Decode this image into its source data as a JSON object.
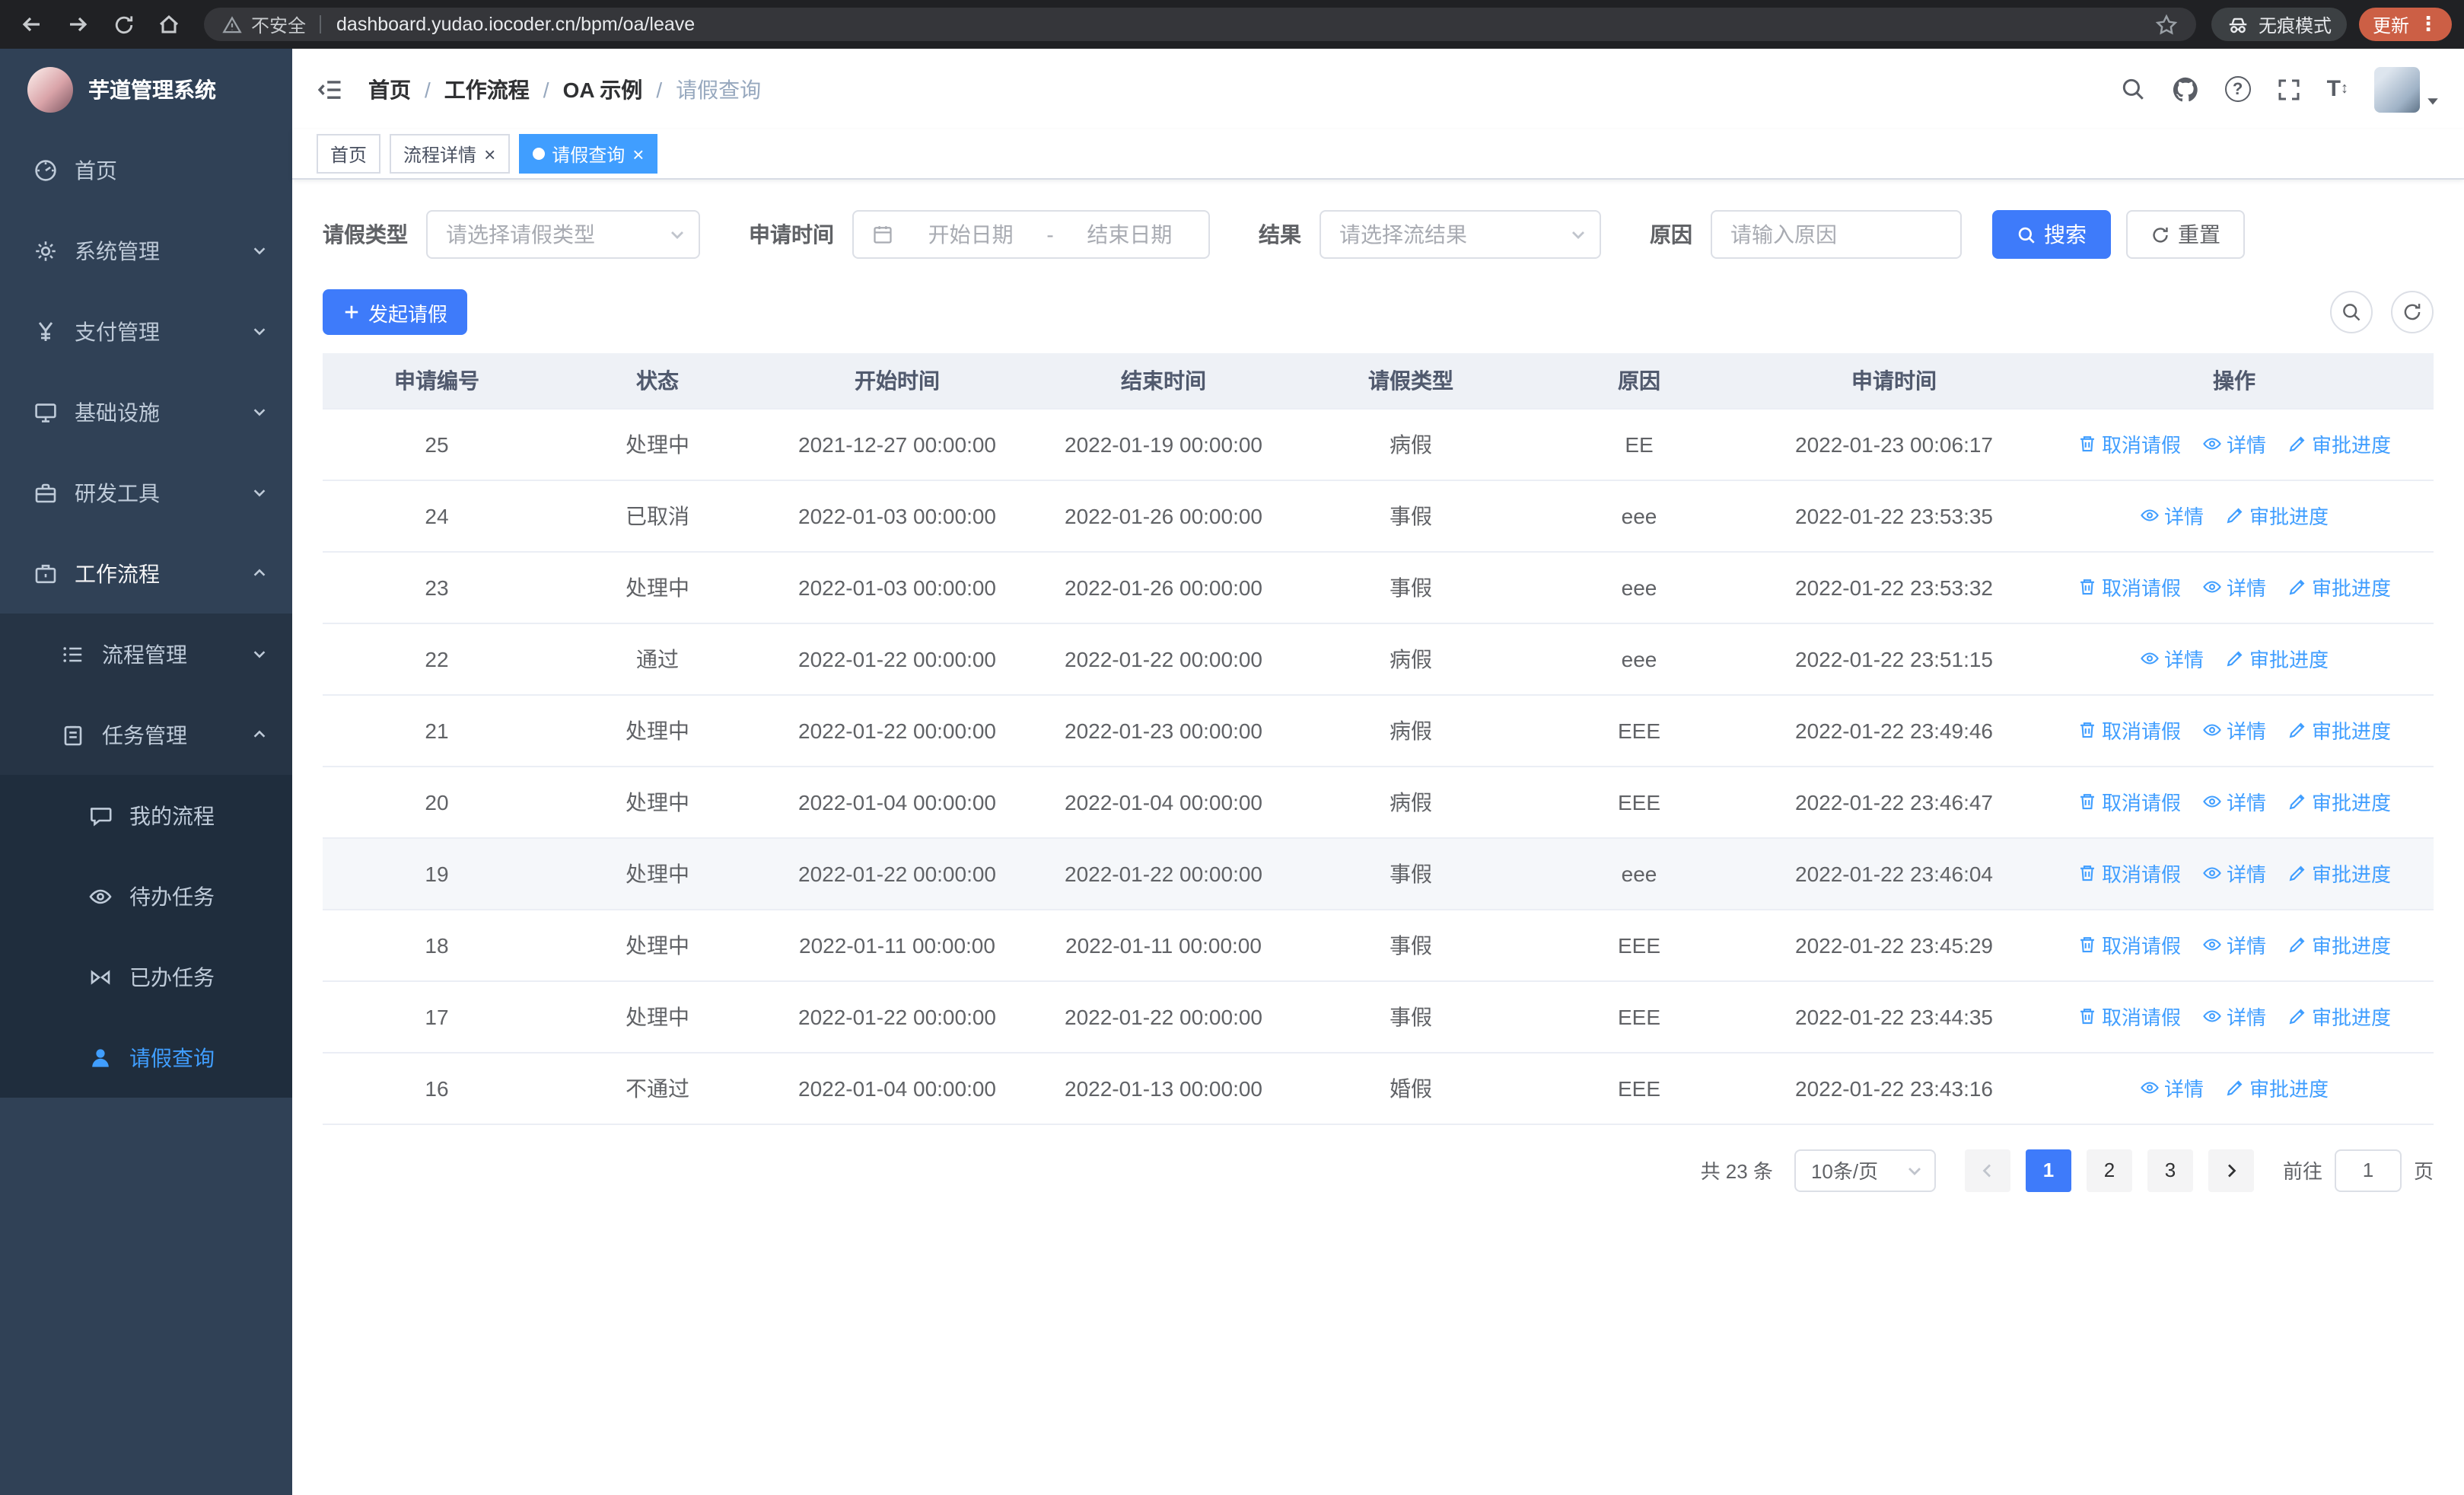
{
  "browser": {
    "security_label": "不安全",
    "url": "dashboard.yudao.iocoder.cn/bpm/oa/leave",
    "incognito_label": "无痕模式",
    "update_label": "更新"
  },
  "sidebar": {
    "app_title": "芋道管理系统",
    "menu": [
      {
        "label": "首页"
      },
      {
        "label": "系统管理"
      },
      {
        "label": "支付管理"
      },
      {
        "label": "基础设施"
      },
      {
        "label": "研发工具"
      },
      {
        "label": "工作流程"
      }
    ],
    "submenu": [
      {
        "label": "流程管理"
      },
      {
        "label": "任务管理"
      }
    ],
    "tasks": [
      {
        "label": "我的流程"
      },
      {
        "label": "待办任务"
      },
      {
        "label": "已办任务"
      },
      {
        "label": "请假查询"
      }
    ]
  },
  "header": {
    "breadcrumb": [
      "首页",
      "工作流程",
      "OA 示例",
      "请假查询"
    ]
  },
  "tabs": [
    {
      "label": "首页"
    },
    {
      "label": "流程详情"
    },
    {
      "label": "请假查询"
    }
  ],
  "filters": {
    "leave_type_label": "请假类型",
    "leave_type_placeholder": "请选择请假类型",
    "apply_time_label": "申请时间",
    "start_date_placeholder": "开始日期",
    "range_separator": "-",
    "end_date_placeholder": "结束日期",
    "result_label": "结果",
    "result_placeholder": "请选择流结果",
    "reason_label": "原因",
    "reason_placeholder": "请输入原因",
    "search_label": "搜索",
    "reset_label": "重置"
  },
  "toolbar": {
    "create_label": "发起请假"
  },
  "table": {
    "columns": [
      "申请编号",
      "状态",
      "开始时间",
      "结束时间",
      "请假类型",
      "原因",
      "申请时间",
      "操作"
    ],
    "action_labels": {
      "cancel": "取消请假",
      "detail": "详情",
      "progress": "审批进度"
    },
    "rows": [
      {
        "id": "25",
        "status": "处理中",
        "start": "2021-12-27 00:00:00",
        "end": "2022-01-19 00:00:00",
        "type": "病假",
        "reason": "EE",
        "applied": "2022-01-23 00:06:17",
        "actions": [
          "cancel",
          "detail",
          "progress"
        ],
        "highlighted": false
      },
      {
        "id": "24",
        "status": "已取消",
        "start": "2022-01-03 00:00:00",
        "end": "2022-01-26 00:00:00",
        "type": "事假",
        "reason": "eee",
        "applied": "2022-01-22 23:53:35",
        "actions": [
          "detail",
          "progress"
        ],
        "highlighted": false
      },
      {
        "id": "23",
        "status": "处理中",
        "start": "2022-01-03 00:00:00",
        "end": "2022-01-26 00:00:00",
        "type": "事假",
        "reason": "eee",
        "applied": "2022-01-22 23:53:32",
        "actions": [
          "cancel",
          "detail",
          "progress"
        ],
        "highlighted": false
      },
      {
        "id": "22",
        "status": "通过",
        "start": "2022-01-22 00:00:00",
        "end": "2022-01-22 00:00:00",
        "type": "病假",
        "reason": "eee",
        "applied": "2022-01-22 23:51:15",
        "actions": [
          "detail",
          "progress"
        ],
        "highlighted": false
      },
      {
        "id": "21",
        "status": "处理中",
        "start": "2022-01-22 00:00:00",
        "end": "2022-01-23 00:00:00",
        "type": "病假",
        "reason": "EEE",
        "applied": "2022-01-22 23:49:46",
        "actions": [
          "cancel",
          "detail",
          "progress"
        ],
        "highlighted": false
      },
      {
        "id": "20",
        "status": "处理中",
        "start": "2022-01-04 00:00:00",
        "end": "2022-01-04 00:00:00",
        "type": "病假",
        "reason": "EEE",
        "applied": "2022-01-22 23:46:47",
        "actions": [
          "cancel",
          "detail",
          "progress"
        ],
        "highlighted": false
      },
      {
        "id": "19",
        "status": "处理中",
        "start": "2022-01-22 00:00:00",
        "end": "2022-01-22 00:00:00",
        "type": "事假",
        "reason": "eee",
        "applied": "2022-01-22 23:46:04",
        "actions": [
          "cancel",
          "detail",
          "progress"
        ],
        "highlighted": true
      },
      {
        "id": "18",
        "status": "处理中",
        "start": "2022-01-11 00:00:00",
        "end": "2022-01-11 00:00:00",
        "type": "事假",
        "reason": "EEE",
        "applied": "2022-01-22 23:45:29",
        "actions": [
          "cancel",
          "detail",
          "progress"
        ],
        "highlighted": false
      },
      {
        "id": "17",
        "status": "处理中",
        "start": "2022-01-22 00:00:00",
        "end": "2022-01-22 00:00:00",
        "type": "事假",
        "reason": "EEE",
        "applied": "2022-01-22 23:44:35",
        "actions": [
          "cancel",
          "detail",
          "progress"
        ],
        "highlighted": false
      },
      {
        "id": "16",
        "status": "不通过",
        "start": "2022-01-04 00:00:00",
        "end": "2022-01-13 00:00:00",
        "type": "婚假",
        "reason": "EEE",
        "applied": "2022-01-22 23:43:16",
        "actions": [
          "detail",
          "progress"
        ],
        "highlighted": false
      }
    ]
  },
  "pagination": {
    "total_label": "共 23 条",
    "page_size_label": "10条/页",
    "pages": [
      "1",
      "2",
      "3"
    ],
    "active_page": "1",
    "goto_label": "前往",
    "goto_value": "1",
    "page_unit_label": "页"
  },
  "colors": {
    "primary": "#409eff",
    "button_primary": "#3e7bfa",
    "sidebar_bg": "#304156",
    "sidebar_sub_bg": "#1f2d3d"
  }
}
